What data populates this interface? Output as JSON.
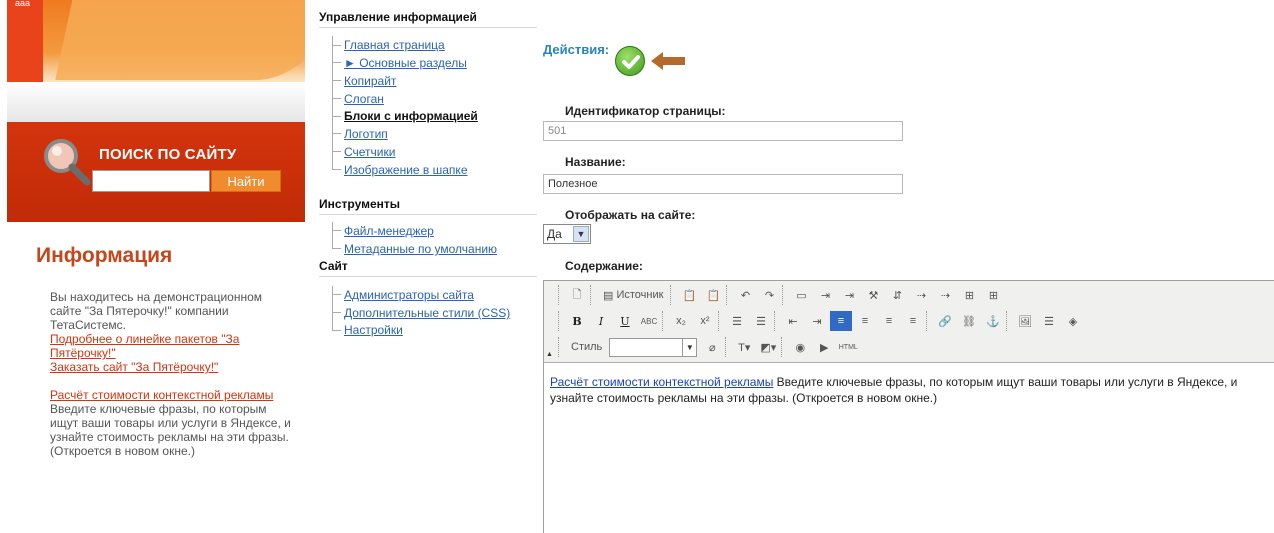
{
  "left": {
    "banner_logo": "ааа",
    "search": {
      "title": "ПОИСК ПО САЙТУ",
      "button": "Найти",
      "input_value": ""
    },
    "info": {
      "title": "Информация",
      "intro": "Вы находитесь на демонстрационном сайте \"За Пятерочку!\" компании ТетаСистемс.",
      "link1": "Подробнее о линейке пакетов \"За Пятёрочку!\"",
      "link2": "Заказать сайт \"За Пятёрочку!\"",
      "link3": "Расчёт стоимости контекстной рекламы",
      "link3_desc": " Введите ключевые фразы, по которым ищут ваши товары или услуги в Яндексе, и узнайте стоимость рекламы на эти фразы. (Откроется в новом окне.)"
    }
  },
  "tree": {
    "section1": "Управление информацией",
    "items1": [
      "Главная страница",
      "► Основные разделы",
      "Копирайт",
      "Слоган",
      "Блоки с информацией",
      "Логотип",
      "Счетчики",
      "Изображение в шапке"
    ],
    "section2": "Инструменты",
    "items2": [
      "Файл-менеджер",
      "Метаданные по умолчанию"
    ],
    "section3": "Сайт",
    "items3": [
      "Администраторы сайта",
      "Дополнительные стили (CSS)",
      "Настройки"
    ]
  },
  "form": {
    "actions_label": "Действия:",
    "page_id_label": "Идентификатор страницы:",
    "page_id_value": "501",
    "name_label": "Название:",
    "name_value": "Полезное",
    "visible_label": "Отображать на сайте:",
    "visible_value": "Да",
    "content_label": "Содержание:"
  },
  "editor": {
    "source_label": "Источник",
    "style_label": "Стиль",
    "bold": "B",
    "italic": "I",
    "underline": "U",
    "abc": "ABC",
    "sub": "x₂",
    "sup": "x²",
    "html_label": "HTML",
    "content_link": "Расчёт стоимости контекстной рекламы",
    "content_text": " Введите ключевые фразы, по которым ищут ваши товары или услуги в Яндексе, и узнайте стоимость рекламы на эти фразы. (Откроется в новом окне.)"
  }
}
